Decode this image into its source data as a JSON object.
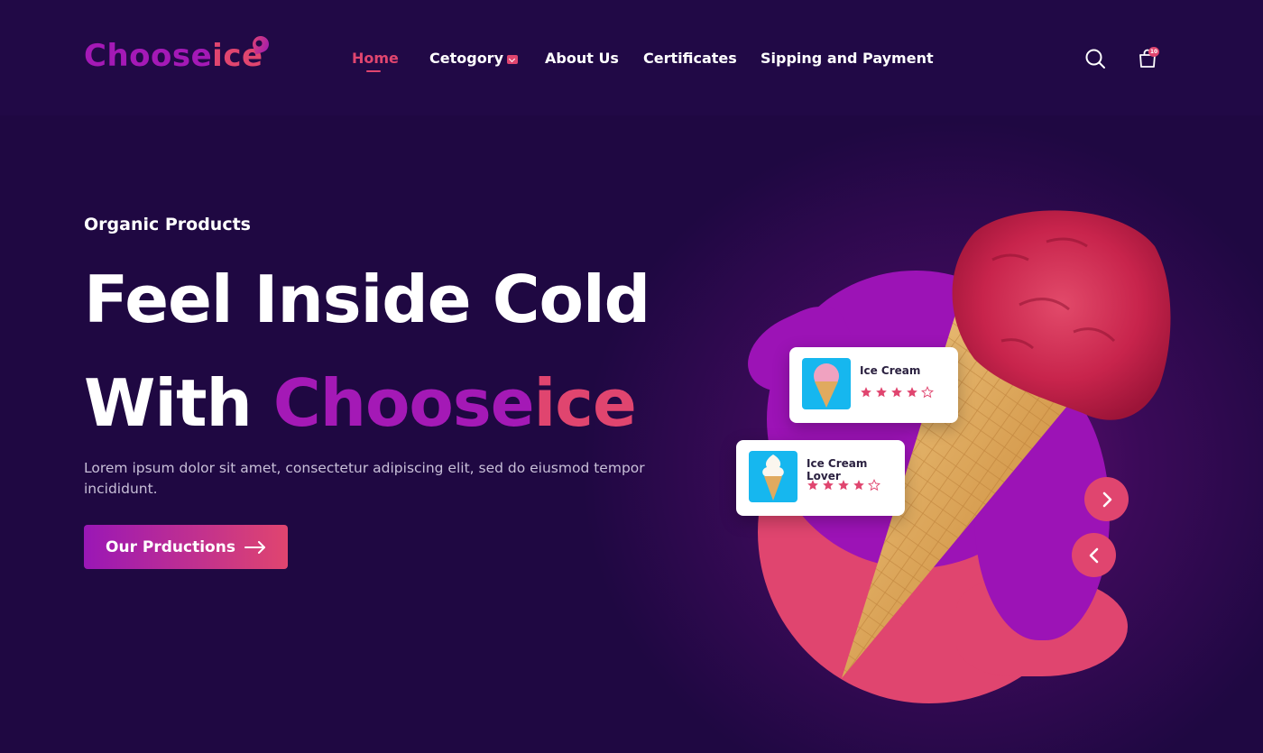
{
  "brand": {
    "part1": "Choose",
    "part2": "ice",
    "accent": "#e0456f",
    "primary": "#a419b6"
  },
  "nav": {
    "items": [
      {
        "label": "Home",
        "active": true
      },
      {
        "label": "Cetogory",
        "has_dropdown": true
      },
      {
        "label": "About Us"
      },
      {
        "label": "Certificates"
      },
      {
        "label": "Sipping and Payment"
      }
    ]
  },
  "header": {
    "search_icon": "search-icon",
    "cart_icon": "shopping-bag-icon",
    "cart_count": "10"
  },
  "hero": {
    "eyebrow": "Organic Products",
    "headline_line1": "Feel Inside Cold",
    "headline_line2_prefix": "With",
    "headline_brand_a": "Choose",
    "headline_brand_b": "ice",
    "description": "Lorem ipsum dolor sit amet, consectetur adipiscing elit, sed do eiusmod tempor incididunt.",
    "cta_label": "Our Prductions",
    "cta_icon": "arrow-right-icon"
  },
  "products": [
    {
      "title": "Ice Cream",
      "rating": 4,
      "max_rating": 5
    },
    {
      "title": "Ice Cream Lover",
      "rating": 4,
      "max_rating": 5
    }
  ],
  "slider": {
    "next_icon": "chevron-right-icon",
    "prev_icon": "chevron-left-icon"
  },
  "colors": {
    "background": "#1f0842",
    "pink": "#e0456f",
    "purple": "#9c13b6",
    "card_thumb": "#16b7ef"
  }
}
